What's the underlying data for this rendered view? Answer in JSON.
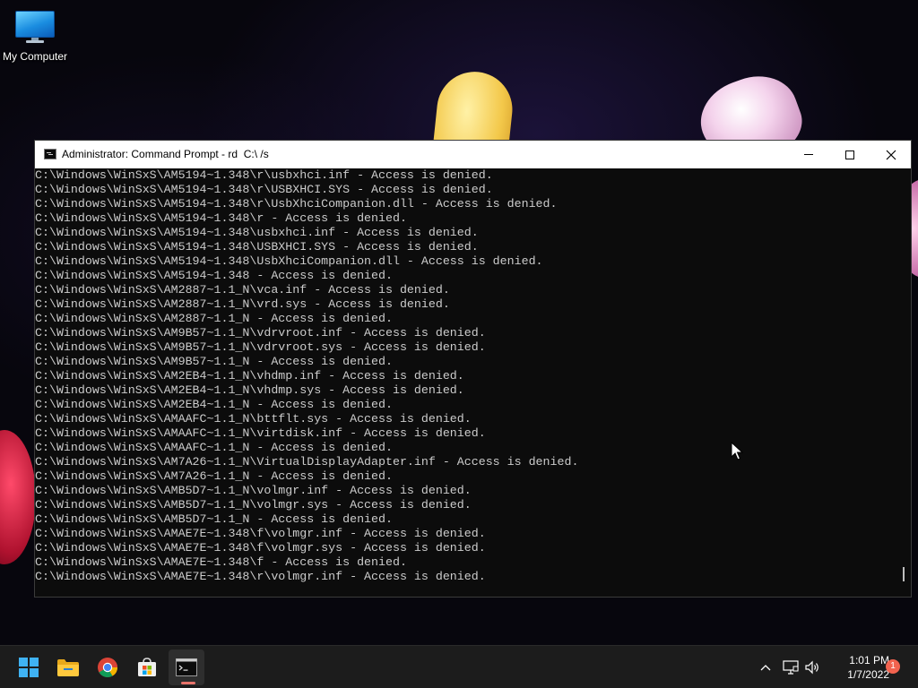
{
  "desktop": {
    "icons": [
      {
        "label": "My Computer",
        "icon": "monitor-icon"
      }
    ]
  },
  "window": {
    "title": "Administrator: Command Prompt - rd  C:\\ /s",
    "controls": {
      "minimize": "minimize-icon",
      "maximize": "maximize-icon",
      "close": "close-icon"
    },
    "lines": [
      "C:\\Windows\\WinSxS\\AM5194~1.348\\r\\usbxhci.inf - Access is denied.",
      "C:\\Windows\\WinSxS\\AM5194~1.348\\r\\USBXHCI.SYS - Access is denied.",
      "C:\\Windows\\WinSxS\\AM5194~1.348\\r\\UsbXhciCompanion.dll - Access is denied.",
      "C:\\Windows\\WinSxS\\AM5194~1.348\\r - Access is denied.",
      "C:\\Windows\\WinSxS\\AM5194~1.348\\usbxhci.inf - Access is denied.",
      "C:\\Windows\\WinSxS\\AM5194~1.348\\USBXHCI.SYS - Access is denied.",
      "C:\\Windows\\WinSxS\\AM5194~1.348\\UsbXhciCompanion.dll - Access is denied.",
      "C:\\Windows\\WinSxS\\AM5194~1.348 - Access is denied.",
      "C:\\Windows\\WinSxS\\AM2887~1.1_N\\vca.inf - Access is denied.",
      "C:\\Windows\\WinSxS\\AM2887~1.1_N\\vrd.sys - Access is denied.",
      "C:\\Windows\\WinSxS\\AM2887~1.1_N - Access is denied.",
      "C:\\Windows\\WinSxS\\AM9B57~1.1_N\\vdrvroot.inf - Access is denied.",
      "C:\\Windows\\WinSxS\\AM9B57~1.1_N\\vdrvroot.sys - Access is denied.",
      "C:\\Windows\\WinSxS\\AM9B57~1.1_N - Access is denied.",
      "C:\\Windows\\WinSxS\\AM2EB4~1.1_N\\vhdmp.inf - Access is denied.",
      "C:\\Windows\\WinSxS\\AM2EB4~1.1_N\\vhdmp.sys - Access is denied.",
      "C:\\Windows\\WinSxS\\AM2EB4~1.1_N - Access is denied.",
      "C:\\Windows\\WinSxS\\AMAAFC~1.1_N\\bttflt.sys - Access is denied.",
      "C:\\Windows\\WinSxS\\AMAAFC~1.1_N\\virtdisk.inf - Access is denied.",
      "C:\\Windows\\WinSxS\\AMAAFC~1.1_N - Access is denied.",
      "C:\\Windows\\WinSxS\\AM7A26~1.1_N\\VirtualDisplayAdapter.inf - Access is denied.",
      "C:\\Windows\\WinSxS\\AM7A26~1.1_N - Access is denied.",
      "C:\\Windows\\WinSxS\\AMB5D7~1.1_N\\volmgr.inf - Access is denied.",
      "C:\\Windows\\WinSxS\\AMB5D7~1.1_N\\volmgr.sys - Access is denied.",
      "C:\\Windows\\WinSxS\\AMB5D7~1.1_N - Access is denied.",
      "C:\\Windows\\WinSxS\\AMAE7E~1.348\\f\\volmgr.inf - Access is denied.",
      "C:\\Windows\\WinSxS\\AMAE7E~1.348\\f\\volmgr.sys - Access is denied.",
      "C:\\Windows\\WinSxS\\AMAE7E~1.348\\f - Access is denied.",
      "C:\\Windows\\WinSxS\\AMAE7E~1.348\\r\\volmgr.inf - Access is denied."
    ]
  },
  "taskbar": {
    "items": [
      {
        "name": "start",
        "icon": "windows-start-icon"
      },
      {
        "name": "file-explorer",
        "icon": "folder-icon"
      },
      {
        "name": "chrome",
        "icon": "chrome-icon"
      },
      {
        "name": "microsoft-store",
        "icon": "store-bag-icon"
      },
      {
        "name": "command-prompt",
        "icon": "terminal-icon",
        "active": true
      }
    ],
    "tray": {
      "icons": [
        "chevron-up-icon",
        "network-icon",
        "volume-icon"
      ],
      "time": "1:01 PM",
      "date": "1/7/2022",
      "notification_count": "1"
    }
  },
  "colors": {
    "console_bg": "#0c0c0c",
    "console_text": "#cccccc",
    "titlebar_bg": "#ffffff",
    "taskbar_bg": "#1c1c1c",
    "start_accent": "#3fb2f3",
    "active_indicator": "#e8746b",
    "notification_badge": "#f2634f"
  }
}
